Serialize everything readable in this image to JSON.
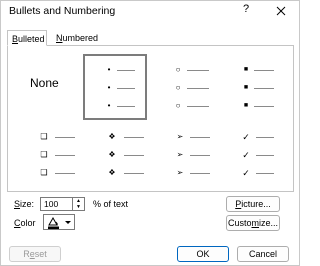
{
  "dialog": {
    "title": "Bullets and Numbering",
    "help_glyph": "?",
    "close_icon": "close-icon"
  },
  "tabs": [
    {
      "label": "Bulleted",
      "mnemonic": "B",
      "rest": "ulleted",
      "active": true
    },
    {
      "label": "Numbered",
      "mnemonic": "N",
      "rest": "umbered",
      "active": false
    }
  ],
  "gallery": {
    "none_label": "None",
    "selected_index": 1,
    "styles": [
      {
        "name": "none"
      },
      {
        "name": "small-dot",
        "glyph": "•"
      },
      {
        "name": "hollow-circle",
        "glyph": "○"
      },
      {
        "name": "filled-square",
        "glyph": "■"
      },
      {
        "name": "hollow-square",
        "glyph": "❑"
      },
      {
        "name": "four-diamond",
        "glyph": "❖"
      },
      {
        "name": "arrowhead",
        "glyph": "➢"
      },
      {
        "name": "checkmark",
        "glyph": "✓"
      }
    ]
  },
  "size": {
    "label": "Size:",
    "mnemonic": "S",
    "rest": "ize:",
    "value": "100",
    "suffix": "% of text"
  },
  "color": {
    "label": "Color",
    "mnemonic": "C",
    "rest": "olor",
    "swatch": "#000000"
  },
  "buttons": {
    "picture_mnemonic": "P",
    "picture_rest": "icture...",
    "customize_pre": "Custo",
    "customize_mnemonic": "m",
    "customize_post": "ize...",
    "reset_pre": "R",
    "reset_mnemonic": "e",
    "reset_post": "set",
    "ok": "OK",
    "cancel": "Cancel"
  }
}
